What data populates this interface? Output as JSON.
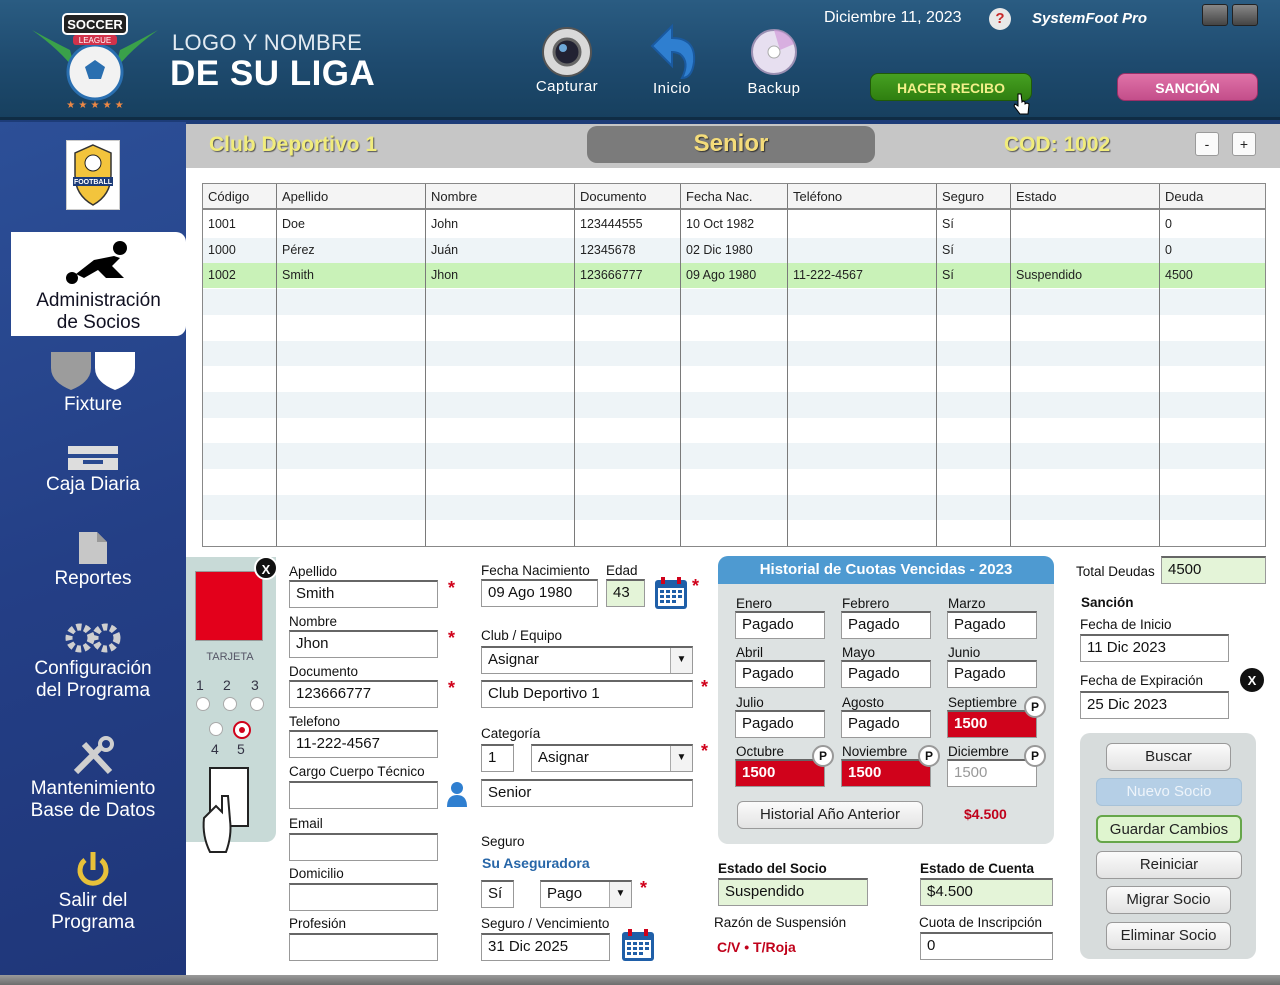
{
  "app": {
    "league_line1": "LOGO Y NOMBRE",
    "league_line2": "DE SU LIGA",
    "badge_top": "SOCCER",
    "badge_mid": "LEAGUE",
    "date": "Diciembre 11, 2023",
    "help": "?",
    "brand": "SystemFoot Pro"
  },
  "toolbar": {
    "capture": "Capturar",
    "home": "Inicio",
    "backup": "Backup",
    "receipt": "HACER RECIBO",
    "sanction": "SANCIÓN"
  },
  "sidebar": {
    "club_logo_text": "FOOTBALL",
    "items": [
      {
        "line1": "Administración",
        "line2": "de Socios"
      },
      {
        "line1": "Fixture",
        "line2": ""
      },
      {
        "line1": "Caja Diaria",
        "line2": ""
      },
      {
        "line1": "Reportes",
        "line2": ""
      },
      {
        "line1": "Configuración",
        "line2": "del Programa"
      },
      {
        "line1": "Mantenimiento",
        "line2": "Base de Datos"
      },
      {
        "line1": "Salir del",
        "line2": "Programa"
      }
    ]
  },
  "header": {
    "club": "Club Deportivo 1",
    "category": "Senior",
    "code": "COD: 1002",
    "minus": "-",
    "plus": "+"
  },
  "table": {
    "columns": [
      "Código",
      "Apellido",
      "Nombre",
      "Documento",
      "Fecha Nac.",
      "Teléfono",
      "Seguro",
      "Estado",
      "Deuda"
    ],
    "rows": [
      [
        "1001",
        "Doe",
        "John",
        "123444555",
        "10 Oct 1982",
        "",
        "Sí",
        "",
        "0"
      ],
      [
        "1000",
        "Pérez",
        "Juán",
        "12345678",
        "02 Dic 1980",
        "",
        "Sí",
        "",
        "0"
      ],
      [
        "1002",
        "Smith",
        "Jhon",
        "123666777",
        "09 Ago 1980",
        "11-222-4567",
        "Sí",
        "Suspendido",
        "4500"
      ]
    ],
    "selected_row": 2
  },
  "card": {
    "close": "X",
    "label": "TARJETA",
    "nums_top": [
      "1",
      "2",
      "3"
    ],
    "nums_bottom": [
      "4",
      "5"
    ],
    "selected": 5,
    "color": "#e3001b"
  },
  "form": {
    "apellido_label": "Apellido",
    "apellido": "Smith",
    "nombre_label": "Nombre",
    "nombre": "Jhon",
    "documento_label": "Documento",
    "documento": "123666777",
    "telefono_label": "Telefono",
    "telefono": "11-222-4567",
    "cargo_label": "Cargo Cuerpo Técnico",
    "cargo": "",
    "email_label": "Email",
    "email": "",
    "domicilio_label": "Domicilio",
    "domicilio": "",
    "profesion_label": "Profesión",
    "profesion": "",
    "fecha_nac_label": "Fecha Nacimiento",
    "fecha_nac": "09 Ago 1980",
    "edad_label": "Edad",
    "edad": "43",
    "club_label": "Club / Equipo",
    "club_select": "Asignar",
    "club": "Club Deportivo 1",
    "categoria_label": "Categoría",
    "categoria_num": "1",
    "categoria_select": "Asignar",
    "categoria": "Senior",
    "seguro_label": "Seguro",
    "aseguradora": "Su Aseguradora",
    "seguro_si": "Sí",
    "seguro_pago": "Pago",
    "vencimiento_label": "Seguro / Vencimiento",
    "vencimiento": "31 Dic 2025",
    "required": "*"
  },
  "history": {
    "title": "Historial de Cuotas Vencidas - 2023",
    "months": [
      {
        "name": "Enero",
        "value": "Pagado",
        "state": "paid"
      },
      {
        "name": "Febrero",
        "value": "Pagado",
        "state": "paid"
      },
      {
        "name": "Marzo",
        "value": "Pagado",
        "state": "paid"
      },
      {
        "name": "Abril",
        "value": "Pagado",
        "state": "paid"
      },
      {
        "name": "Mayo",
        "value": "Pagado",
        "state": "paid"
      },
      {
        "name": "Junio",
        "value": "Pagado",
        "state": "paid"
      },
      {
        "name": "Julio",
        "value": "Pagado",
        "state": "paid"
      },
      {
        "name": "Agosto",
        "value": "Pagado",
        "state": "paid"
      },
      {
        "name": "Septiembre",
        "value": "1500",
        "state": "due"
      },
      {
        "name": "Octubre",
        "value": "1500",
        "state": "due"
      },
      {
        "name": "Noviembre",
        "value": "1500",
        "state": "due"
      },
      {
        "name": "Diciembre",
        "value": "1500",
        "state": "pending"
      }
    ],
    "pay_label": "P",
    "prev_year_button": "Historial Año Anterior",
    "total": "$4.500"
  },
  "status": {
    "estado_socio_label": "Estado del Socio",
    "estado_socio": "Suspendido",
    "estado_cuenta_label": "Estado de Cuenta",
    "estado_cuenta": "$4.500",
    "razon_label": "Razón de Suspensión",
    "razon": "C/V • T/Roja",
    "inscripcion_label": "Cuota de Inscripción",
    "inscripcion": "0"
  },
  "sanction": {
    "total_deudas_label": "Total Deudas",
    "total_deudas": "4500",
    "title": "Sanción",
    "inicio_label": "Fecha de Inicio",
    "inicio": "11 Dic 2023",
    "expiracion_label": "Fecha de Expiración",
    "expiracion": "25 Dic 2023",
    "close": "X"
  },
  "actions": {
    "buscar": "Buscar",
    "nuevo": "Nuevo Socio",
    "guardar": "Guardar Cambios",
    "reiniciar": "Reiniciar",
    "migrar": "Migrar Socio",
    "eliminar": "Eliminar Socio"
  }
}
